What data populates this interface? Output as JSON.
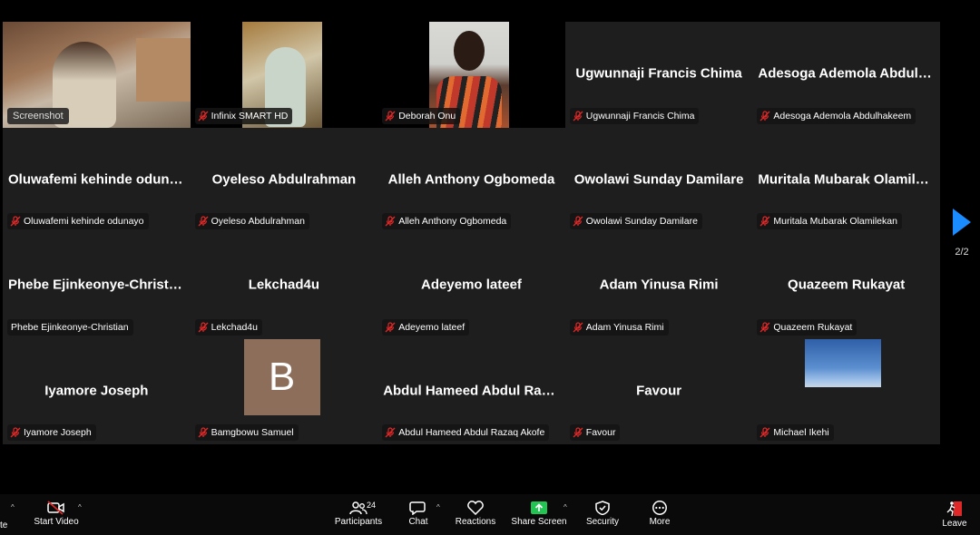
{
  "tiles": [
    {
      "name": "",
      "label": "",
      "video": "v1",
      "badge": "Screenshot"
    },
    {
      "name": "",
      "label": "Infinix SMART HD",
      "video": "v2"
    },
    {
      "name": "",
      "label": "Deborah Onu",
      "video": "v3"
    },
    {
      "name": "Ugwunnaji Francis Chima",
      "label": "Ugwunnaji Francis Chima"
    },
    {
      "name": "Adesoga Ademola Abdulha...",
      "label": "Adesoga Ademola Abdulhakeem"
    },
    {
      "name": "Oluwafemi kehinde odunayo",
      "label": "Oluwafemi kehinde odunayo"
    },
    {
      "name": "Oyeleso Abdulrahman",
      "label": "Oyeleso Abdulrahman"
    },
    {
      "name": "Alleh Anthony Ogbomeda",
      "label": "Alleh Anthony Ogbomeda"
    },
    {
      "name": "Owolawi Sunday Damilare",
      "label": "Owolawi Sunday Damilare"
    },
    {
      "name": "Muritala Mubarak Olamilekan",
      "label": "Muritala Mubarak Olamilekan"
    },
    {
      "name": "Phebe Ejinkeonye-Christian",
      "label": "Phebe Ejinkeonye-Christian",
      "nomic": true
    },
    {
      "name": "Lekchad4u",
      "label": "Lekchad4u"
    },
    {
      "name": "Adeyemo lateef",
      "label": "Adeyemo lateef"
    },
    {
      "name": "Adam Yinusa Rimi",
      "label": "Adam Yinusa Rimi"
    },
    {
      "name": "Quazeem Rukayat",
      "label": "Quazeem Rukayat"
    },
    {
      "name": "Iyamore Joseph",
      "label": "Iyamore Joseph"
    },
    {
      "name": "",
      "label": "Bamgbowu Samuel",
      "avatar": "B"
    },
    {
      "name": "Abdul Hameed Abdul Razaq...",
      "label": "Abdul Hameed Abdul Razaq Akofe"
    },
    {
      "name": "Favour",
      "label": "Favour"
    },
    {
      "name": "",
      "label": "Michael Ikehi",
      "sky": true
    }
  ],
  "pager": {
    "page": "2/2"
  },
  "toolbar": {
    "mute_partial": "te",
    "start_video": "Start Video",
    "participants": "Participants",
    "participants_count": "24",
    "chat": "Chat",
    "reactions": "Reactions",
    "share_screen": "Share Screen",
    "security": "Security",
    "more": "More",
    "leave": "Leave"
  },
  "colors": {
    "accent": "#1a8cff",
    "share": "#23c552",
    "leave": "#e02828",
    "mic_muted": "#e02828"
  }
}
